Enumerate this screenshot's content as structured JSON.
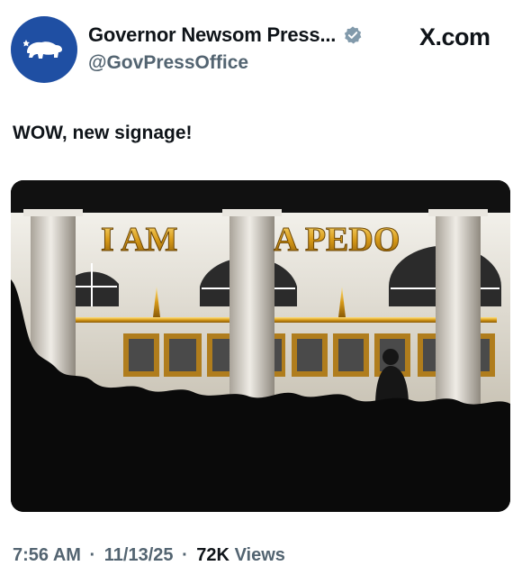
{
  "author": {
    "display_name": "Governor Newsom Press...",
    "handle": "@GovPressOffice",
    "avatar_icon": "bear-icon",
    "verified_icon": "verified-badge-icon"
  },
  "brand": "X.com",
  "tweet": {
    "text": "WOW, new signage!",
    "image_sign_text_left": "I AM",
    "image_sign_text_right": "A PEDO"
  },
  "meta": {
    "time": "7:56 AM",
    "date": "11/13/25",
    "views_count": "72K",
    "views_label": "Views"
  },
  "colors": {
    "avatar_bg": "#1f4fa3",
    "text_primary": "#0f1419",
    "text_secondary": "#536471",
    "gold": "#d79a18"
  }
}
